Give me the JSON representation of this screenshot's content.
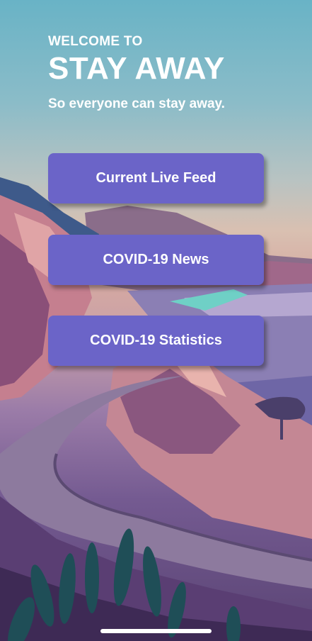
{
  "hero": {
    "welcome": "WELCOME TO",
    "app_name": "STAY AWAY",
    "tagline": "So everyone can stay away."
  },
  "menu": {
    "live_feed": "Current Live Feed",
    "news": "COVID-19 News",
    "statistics": "COVID-19 Statistics"
  },
  "colors": {
    "button": "#6b64c8",
    "sky_top": "#69b3c6",
    "text": "#ffffff"
  }
}
